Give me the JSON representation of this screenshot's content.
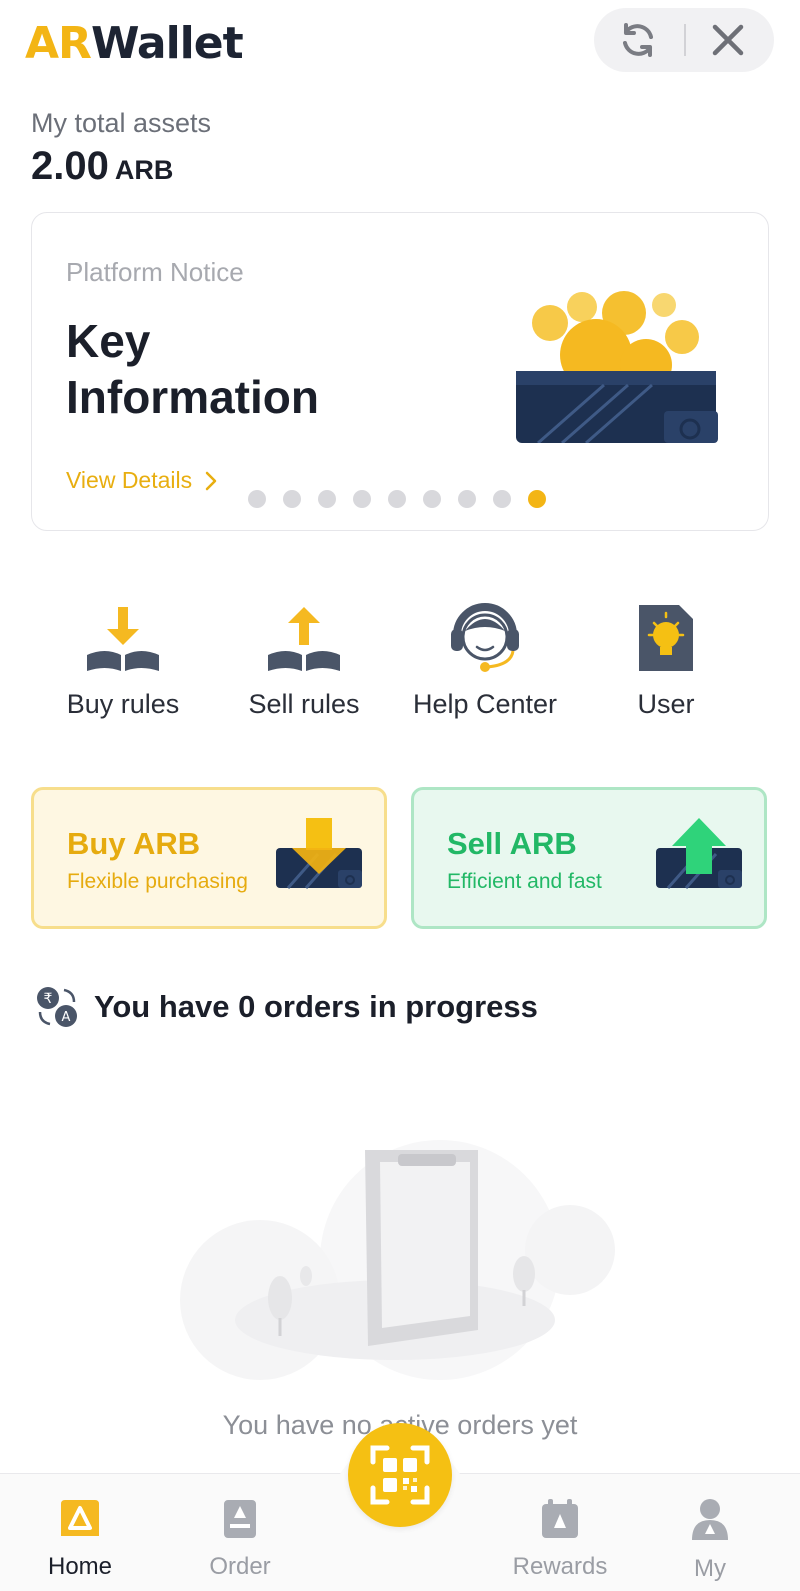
{
  "header": {
    "logo_ar": "AR",
    "logo_wallet": "Wallet",
    "refresh_icon": "refresh-icon",
    "close_icon": "close-icon"
  },
  "assets": {
    "label": "My total assets",
    "value": "2.00",
    "unit": "ARB"
  },
  "notice": {
    "label": "Platform Notice",
    "title": "Key Information",
    "link": "View Details",
    "slide_count": 9,
    "active_slide": 9
  },
  "quick_actions": [
    {
      "label": "Buy rules",
      "icon": "book-download-icon"
    },
    {
      "label": "Sell rules",
      "icon": "book-upload-icon"
    },
    {
      "label": "Help Center",
      "icon": "headset-icon"
    },
    {
      "label": "User",
      "icon": "lightbulb-card-icon"
    }
  ],
  "trade": {
    "buy_title": "Buy ARB",
    "buy_sub": "Flexible purchasing",
    "sell_title": "Sell ARB",
    "sell_sub": "Efficient and fast"
  },
  "orders": {
    "status_text": "You have 0 orders in progress",
    "empty_text": "You have no active orders yet"
  },
  "nav": {
    "items": [
      {
        "label": "Home",
        "icon": "home-icon"
      },
      {
        "label": "Order",
        "icon": "order-icon"
      },
      {
        "label": "Rewards",
        "icon": "calendar-icon"
      },
      {
        "label": "My",
        "icon": "profile-icon"
      }
    ],
    "active": "Home",
    "scan_icon": "scan-qr-icon"
  },
  "colors": {
    "accent": "#f3b515",
    "sell_green": "#22b866",
    "navy": "#1d3050"
  }
}
